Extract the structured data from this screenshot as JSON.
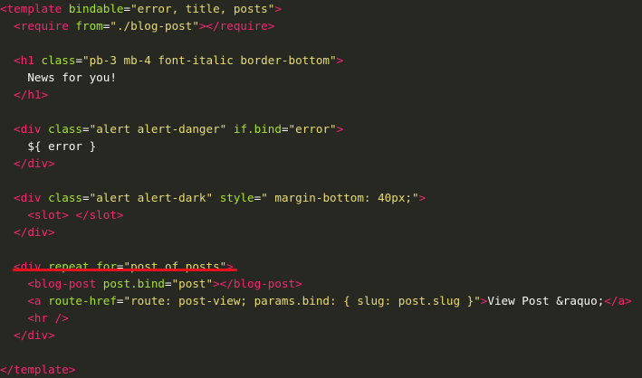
{
  "code_lines": [
    [
      {
        "t": "tag",
        "v": "<template "
      },
      {
        "t": "attr",
        "v": "bindable"
      },
      {
        "t": "eq",
        "v": "="
      },
      {
        "t": "str",
        "v": "\"error, title, posts\""
      },
      {
        "t": "tag",
        "v": ">"
      }
    ],
    [
      {
        "t": "txt",
        "v": "  "
      },
      {
        "t": "tag",
        "v": "<require "
      },
      {
        "t": "attr",
        "v": "from"
      },
      {
        "t": "eq",
        "v": "="
      },
      {
        "t": "str",
        "v": "\"./blog-post\""
      },
      {
        "t": "tag",
        "v": "></require>"
      }
    ],
    [],
    [
      {
        "t": "txt",
        "v": "  "
      },
      {
        "t": "tag",
        "v": "<h1 "
      },
      {
        "t": "attr",
        "v": "class"
      },
      {
        "t": "eq",
        "v": "="
      },
      {
        "t": "str",
        "v": "\"pb-3 mb-4 font-italic border-bottom\""
      },
      {
        "t": "tag",
        "v": ">"
      }
    ],
    [
      {
        "t": "txt",
        "v": "    News for you!"
      }
    ],
    [
      {
        "t": "txt",
        "v": "  "
      },
      {
        "t": "tag",
        "v": "</h1>"
      }
    ],
    [],
    [
      {
        "t": "txt",
        "v": "  "
      },
      {
        "t": "tag",
        "v": "<div "
      },
      {
        "t": "attr",
        "v": "class"
      },
      {
        "t": "eq",
        "v": "="
      },
      {
        "t": "str",
        "v": "\"alert alert-danger\""
      },
      {
        "t": "txt",
        "v": " "
      },
      {
        "t": "attr",
        "v": "if.bind"
      },
      {
        "t": "eq",
        "v": "="
      },
      {
        "t": "str",
        "v": "\"error\""
      },
      {
        "t": "tag",
        "v": ">"
      }
    ],
    [
      {
        "t": "txt",
        "v": "    ${ error }"
      }
    ],
    [
      {
        "t": "txt",
        "v": "  "
      },
      {
        "t": "tag",
        "v": "</div>"
      }
    ],
    [],
    [
      {
        "t": "txt",
        "v": "  "
      },
      {
        "t": "tag",
        "v": "<div "
      },
      {
        "t": "attr",
        "v": "class"
      },
      {
        "t": "eq",
        "v": "="
      },
      {
        "t": "str",
        "v": "\"alert alert-dark\""
      },
      {
        "t": "txt",
        "v": " "
      },
      {
        "t": "attr",
        "v": "style"
      },
      {
        "t": "eq",
        "v": "="
      },
      {
        "t": "str",
        "v": "\" margin-bottom: 40px;\""
      },
      {
        "t": "tag",
        "v": ">"
      }
    ],
    [
      {
        "t": "txt",
        "v": "    "
      },
      {
        "t": "tag",
        "v": "<slot> </slot>"
      }
    ],
    [
      {
        "t": "txt",
        "v": "  "
      },
      {
        "t": "tag",
        "v": "</div>"
      }
    ],
    [],
    [
      {
        "t": "txt",
        "v": "  "
      },
      {
        "t": "tag",
        "v": "<div "
      },
      {
        "t": "attr",
        "v": "repeat.for"
      },
      {
        "t": "eq",
        "v": "="
      },
      {
        "t": "str",
        "v": "\"post of posts\""
      },
      {
        "t": "tag",
        "v": ">"
      }
    ],
    [
      {
        "t": "txt",
        "v": "    "
      },
      {
        "t": "tag",
        "v": "<blog-post "
      },
      {
        "t": "attr",
        "v": "post.bind"
      },
      {
        "t": "eq",
        "v": "="
      },
      {
        "t": "str",
        "v": "\"post\""
      },
      {
        "t": "tag",
        "v": "></blog-post>"
      }
    ],
    [
      {
        "t": "txt",
        "v": "    "
      },
      {
        "t": "tag",
        "v": "<a "
      },
      {
        "t": "attr",
        "v": "route-href"
      },
      {
        "t": "eq",
        "v": "="
      },
      {
        "t": "str",
        "v": "\"route: post-view; params.bind: { slug: post.slug }\""
      },
      {
        "t": "tag",
        "v": ">"
      },
      {
        "t": "txt",
        "v": "View Post &raquo;"
      },
      {
        "t": "tag",
        "v": "</a>"
      }
    ],
    [
      {
        "t": "txt",
        "v": "    "
      },
      {
        "t": "tag",
        "v": "<hr />"
      }
    ],
    [
      {
        "t": "txt",
        "v": "  "
      },
      {
        "t": "tag",
        "v": "</div>"
      }
    ],
    [],
    [
      {
        "t": "tag",
        "v": "</template>"
      }
    ]
  ],
  "colors": {
    "background": "#272822",
    "tag": "#f92672",
    "attribute": "#a6e22e",
    "string": "#e6db74",
    "text": "#f8f8f2",
    "annotation_underline": "#e8101c"
  }
}
